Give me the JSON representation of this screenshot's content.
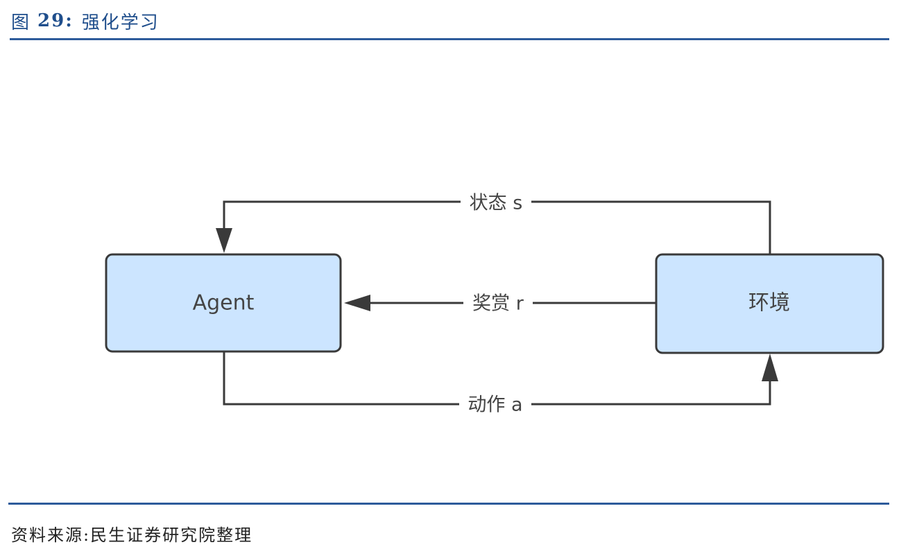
{
  "figure": {
    "prefix": "图",
    "number": "29:",
    "title": "强化学习"
  },
  "diagram": {
    "nodes": {
      "agent": "Agent",
      "environment": "环境"
    },
    "edges": {
      "state": "状态 s",
      "reward": "奖赏 r",
      "action": "动作 a"
    }
  },
  "source": "资料来源:民生证券研究院整理",
  "colors": {
    "title_blue": "#1f4e8c",
    "rule_blue": "#2d5b9b",
    "node_fill": "#cce5ff",
    "line": "#3a3a3a",
    "label_text": "#444444"
  }
}
